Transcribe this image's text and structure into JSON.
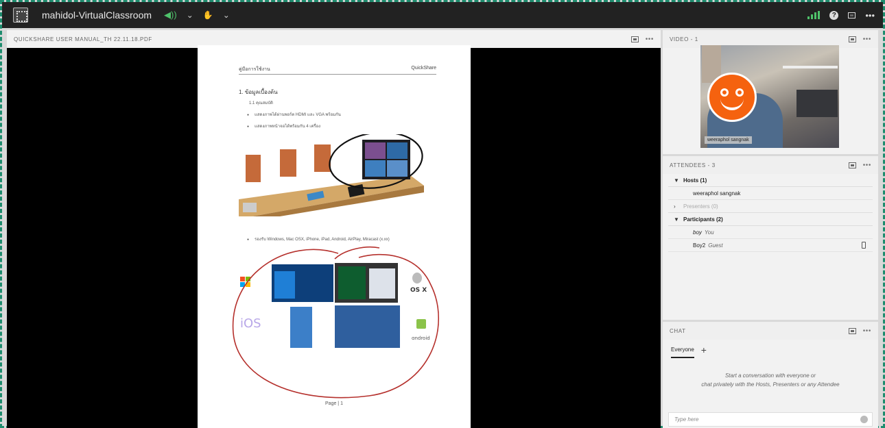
{
  "topbar": {
    "title": "mahidol-VirtualClassroom",
    "speaker_icon": "speaker-icon",
    "hand_icon": "raise-hand-icon"
  },
  "share_pod": {
    "title": "QUICKSHARE USER MANUAL_TH 22.11.18.PDF",
    "doc": {
      "header_left": "คู่มือการใช้งาน",
      "header_right": "QuickShare",
      "section": "1.  ข้อมูลเบื้องต้น",
      "subsection": "1.1  คุณสมบัติ",
      "bullet1": "แสดงภาพได้ผ่านพอร์ต HDMI และ VGA พร้อมกัน",
      "bullet2": "แสดงภาพหน้าจอได้พร้อมกัน 4 เครื่อง",
      "bullet3": "รองรับ Windows, Mac OSX, iPhone, iPad, Android, AirPlay, Miracast (x.xx)",
      "page": "Page | 1"
    }
  },
  "video_pod": {
    "title": "VIDEO - 1",
    "name": "weeraphol sangnak"
  },
  "attendees_pod": {
    "title": "ATTENDEES - 3",
    "hosts_label": "Hosts (1)",
    "host_name": "weeraphol sangnak",
    "presenters_label": "Presenters (0)",
    "participants_label": "Participants (2)",
    "p1_name": "boy",
    "p1_role": "You",
    "p2_name": "Boy2",
    "p2_role": "Guest"
  },
  "chat_pod": {
    "title": "CHAT",
    "tab": "Everyone",
    "empty_line1": "Start a conversation with everyone or",
    "empty_line2": "chat privately with the Hosts, Presenters or any Attendee",
    "placeholder": "Type here"
  },
  "colors": {
    "accent_green": "#4fc26b",
    "frame_border": "#1e8c6e",
    "avatar_orange": "#f5620f",
    "annotation_red": "#b5302c"
  }
}
